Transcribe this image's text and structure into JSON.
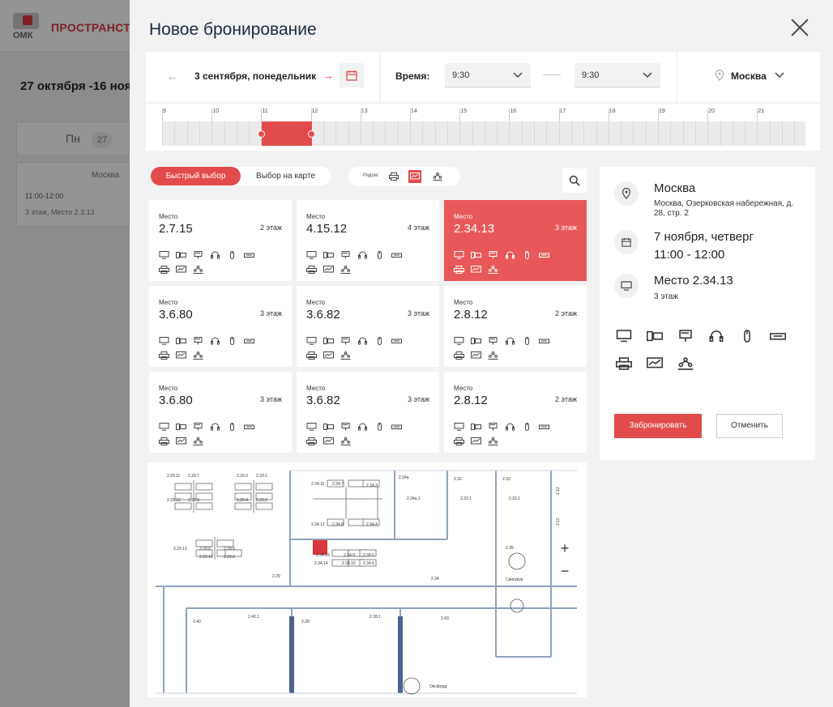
{
  "background": {
    "logo_text": "ОМК",
    "brand": "ПРОСТРАНСТ",
    "date_range": "27 октября -16 ноя",
    "day_name": "Пн",
    "day_num": "27",
    "slot": {
      "city": "Москва",
      "time": "11:00-12:00",
      "place": "3 этаж, Место 2.3.13"
    }
  },
  "modal": {
    "title": "Новое бронирование",
    "filters": {
      "date": "3 сентября, понедельник",
      "time_label": "Время:",
      "time_from": "9:30",
      "time_to": "9:30",
      "city": "Москва"
    },
    "timeline": {
      "hours": [
        "9",
        "10",
        "11",
        "12",
        "13",
        "14",
        "15",
        "16",
        "17",
        "18",
        "19",
        "20",
        "21"
      ],
      "selection_start_hour": 11.0,
      "selection_end_hour": 12.0
    },
    "tabs": {
      "quick": "Быстрый выбор",
      "map": "Выбор на карте"
    },
    "near_label": "Рядом:",
    "cards": [
      {
        "title": "Место",
        "id": "2.7.15",
        "floor": "2 этаж",
        "selected": false
      },
      {
        "title": "Место",
        "id": "4.15.12",
        "floor": "4 этаж",
        "selected": false
      },
      {
        "title": "Место",
        "id": "2.34.13",
        "floor": "3 этаж",
        "selected": true
      },
      {
        "title": "Место",
        "id": "3.6.80",
        "floor": "3 этаж",
        "selected": false
      },
      {
        "title": "Место",
        "id": "3.6.82",
        "floor": "3 этаж",
        "selected": false
      },
      {
        "title": "Место",
        "id": "2.8.12",
        "floor": "2 этаж",
        "selected": false
      },
      {
        "title": "Место",
        "id": "3.6.80",
        "floor": "3 этаж",
        "selected": false
      },
      {
        "title": "Место",
        "id": "3.6.82",
        "floor": "3 этаж",
        "selected": false
      },
      {
        "title": "Место",
        "id": "2.8.12",
        "floor": "2 этаж",
        "selected": false
      }
    ],
    "card_icons": [
      "monitor-icon",
      "laptop-icon",
      "phone-icon",
      "headset-icon",
      "mouse-icon",
      "keyboard-icon",
      "printer-icon",
      "board-icon",
      "team-icon"
    ],
    "map": {
      "zoom_in": "+",
      "zoom_out": "−",
      "labels": [
        "2.29.11",
        "2.29.7",
        "2.29.3",
        "2.29.1",
        "2.29.12",
        "2.29.8",
        "2.29.4",
        "2.29.2",
        "2.29.13",
        "2.29.9",
        "2.29.10",
        "2.29.5",
        "2.29.6",
        "2.29",
        "2.34.11",
        "2.34.7",
        "2.34.3",
        "2.34.12",
        "2.34.8",
        "2.34.4",
        "2.34.13",
        "2.34.9",
        "2.34.5",
        "2.34.14",
        "2.34.10",
        "2.34.6",
        "2.34",
        "2.34a",
        "2.34a.1",
        "2.32",
        "2.32.1",
        "2.33",
        "2.33.1",
        "2.12",
        "2.11",
        "2.35",
        "Сингапур",
        "2.40",
        "2.40.1",
        "2.28",
        "2.28.1",
        "2.43",
        "Оксфорд"
      ]
    },
    "details": {
      "city": "Москва",
      "address": "Москва, Озерковская набережная, д. 28, стр. 2",
      "date": "7 ноября, четверг",
      "time": "11:00 - 12:00",
      "seat": "Место 2.34.13",
      "floor": "3 этаж",
      "book": "Забронировать",
      "cancel": "Отменить"
    },
    "accent": "#e24b4b"
  }
}
